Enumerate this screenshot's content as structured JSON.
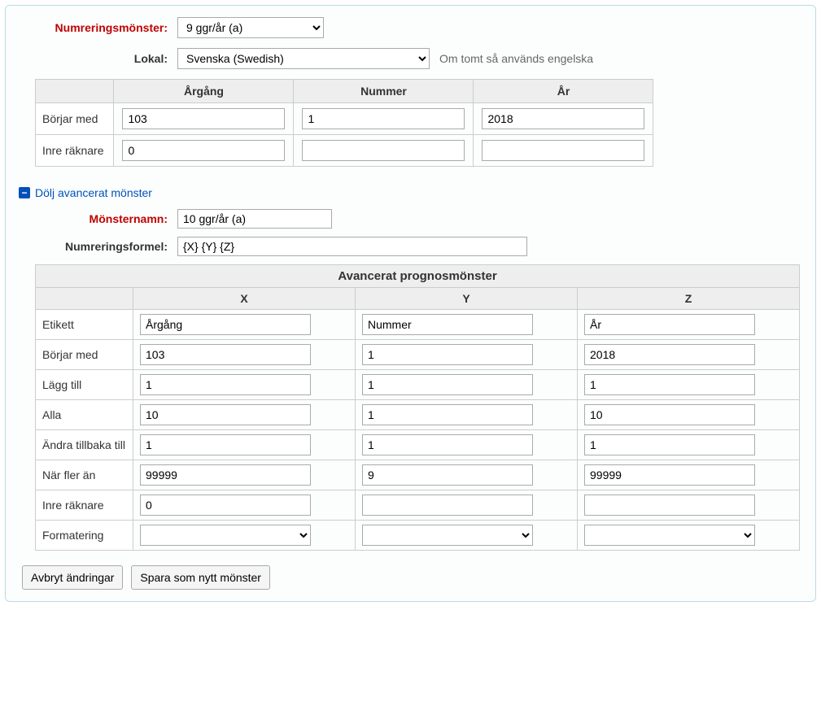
{
  "top": {
    "numbering_label": "Numreringsmönster:",
    "numbering_value": "9 ggr/år (a)",
    "locale_label": "Lokal:",
    "locale_value": "Svenska (Swedish)",
    "locale_hint": "Om tomt så används engelska"
  },
  "simple_table": {
    "headers": {
      "col1": "Årgång",
      "col2": "Nummer",
      "col3": "År"
    },
    "rows": {
      "starts_with": {
        "label": "Börjar med",
        "col1": "103",
        "col2": "1",
        "col3": "2018"
      },
      "inner_counter": {
        "label": "Inre räknare",
        "col1": "0",
        "col2": "",
        "col3": ""
      }
    }
  },
  "toggle": {
    "label": "Dölj avancerat mönster"
  },
  "advanced": {
    "pattern_name_label": "Mönsternamn:",
    "pattern_name_value": "10 ggr/år (a)",
    "formula_label": "Numreringsformel:",
    "formula_value": "{X} {Y} {Z}",
    "table_title": "Avancerat prognosmönster",
    "headers": {
      "x": "X",
      "y": "Y",
      "z": "Z"
    },
    "rows": {
      "etikett": {
        "label": "Etikett",
        "x": "Årgång",
        "y": "Nummer",
        "z": "År"
      },
      "borjar": {
        "label": "Börjar med",
        "x": "103",
        "y": "1",
        "z": "2018"
      },
      "lagg": {
        "label": "Lägg till",
        "x": "1",
        "y": "1",
        "z": "1"
      },
      "alla": {
        "label": "Alla",
        "x": "10",
        "y": "1",
        "z": "10"
      },
      "andra": {
        "label": "Ändra tillbaka till",
        "x": "1",
        "y": "1",
        "z": "1"
      },
      "narfler": {
        "label": "När fler än",
        "x": "99999",
        "y": "9",
        "z": "99999"
      },
      "inre": {
        "label": "Inre räknare",
        "x": "0",
        "y": "",
        "z": ""
      },
      "format": {
        "label": "Formatering",
        "x": "",
        "y": "",
        "z": ""
      }
    }
  },
  "buttons": {
    "cancel": "Avbryt ändringar",
    "save_new": "Spara som nytt mönster"
  }
}
